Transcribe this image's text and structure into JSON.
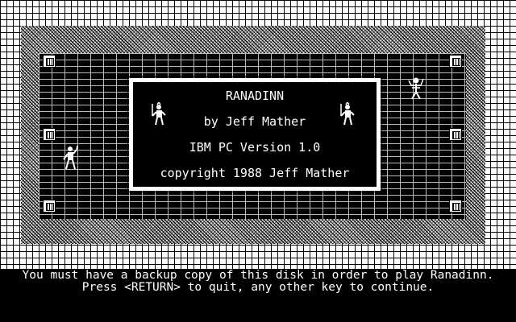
{
  "title_box": {
    "game_title": "RANADINN",
    "author_line": "by Jeff Mather",
    "version_line": "IBM PC Version 1.0",
    "copyright_line": "copyright 1988 Jeff Mather"
  },
  "message": {
    "line1": "You must have a backup copy of this disk in order to play Ranadinn.",
    "line2": "Press <RETURN> to quit, any other key to continue."
  },
  "figures": [
    {
      "name": "warrior-figure-left-of-title",
      "icon": "warrior-with-sword"
    },
    {
      "name": "warrior-figure-right-of-title",
      "icon": "warrior-with-sword"
    },
    {
      "name": "adventurer-figure-left",
      "icon": "adventurer-with-staff"
    },
    {
      "name": "skeleton-figure-right",
      "icon": "skeleton-creature"
    }
  ],
  "colors": {
    "background": "#000000",
    "foreground": "#ffffff"
  }
}
